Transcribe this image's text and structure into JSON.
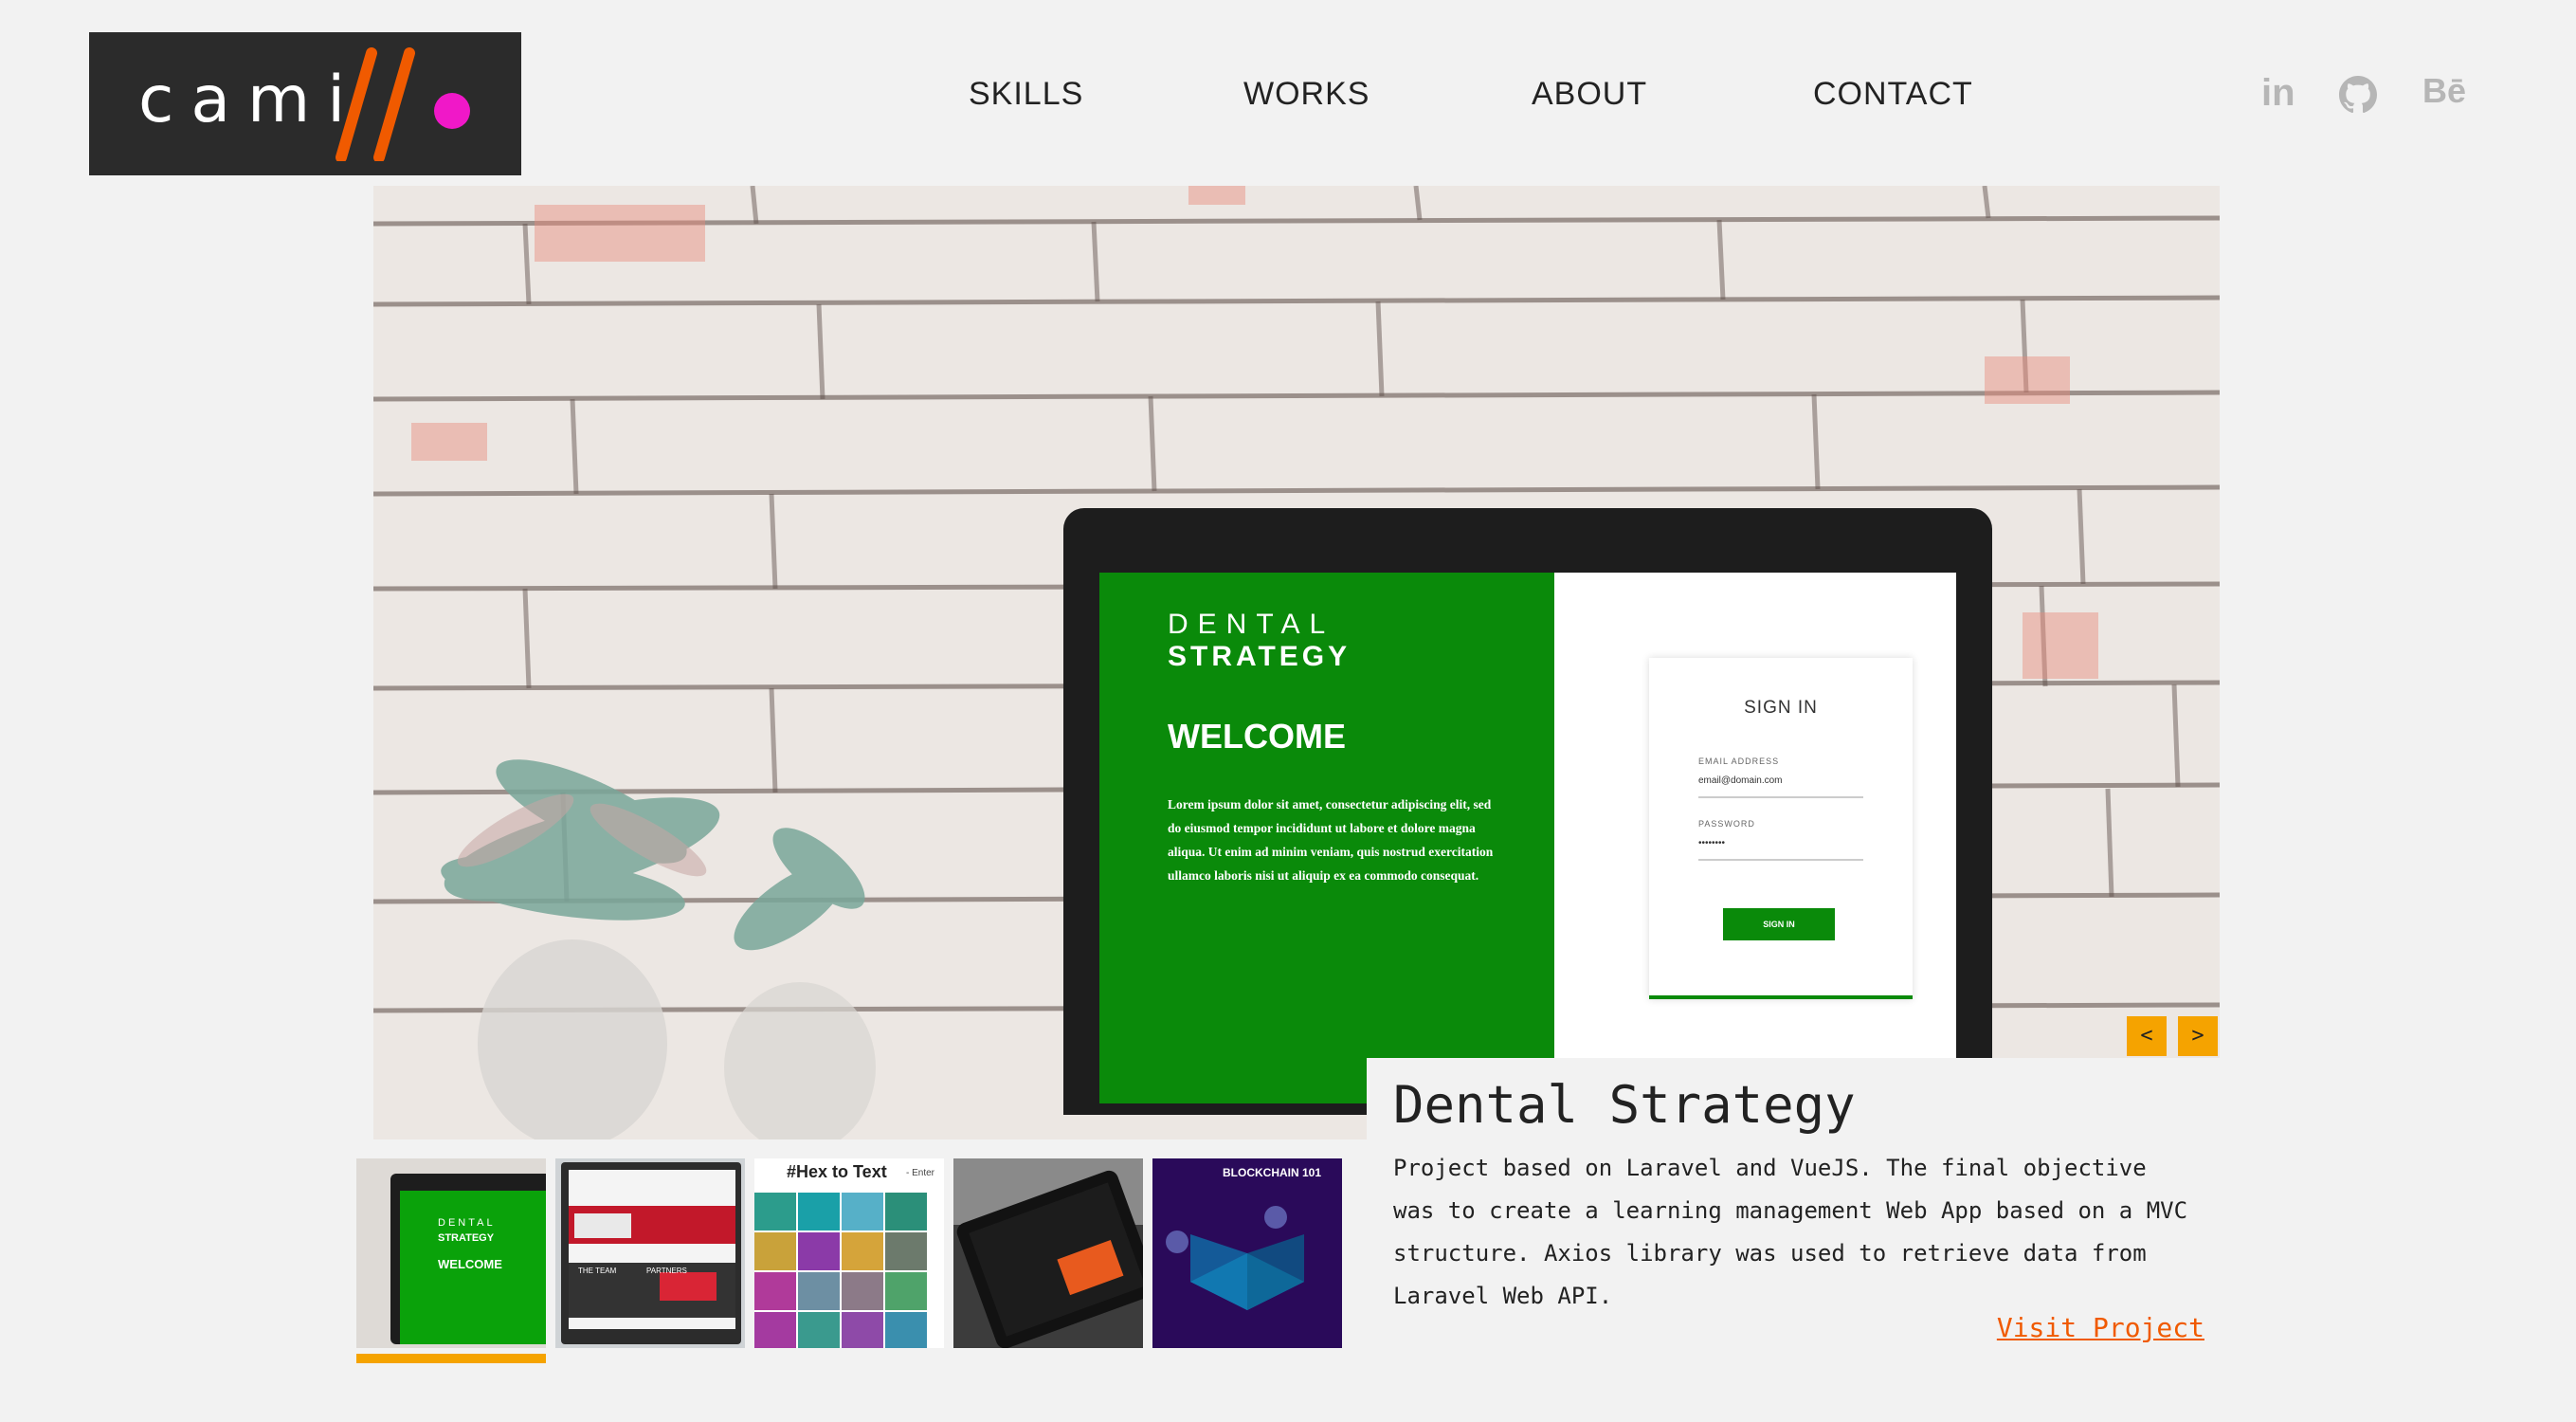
{
  "logo": {
    "text": "cami"
  },
  "nav": {
    "items": [
      "SKILLS",
      "WORKS",
      "ABOUT",
      "CONTACT"
    ]
  },
  "social": {
    "linkedin": "in",
    "github_icon": "github-icon",
    "behance": "Bē"
  },
  "hero": {
    "screen": {
      "brand_top": "DENTAL",
      "brand_bottom": "STRATEGY",
      "welcome": "WELCOME",
      "lorem": "Lorem ipsum dolor sit amet, consectetur adipiscing elit, sed do eiusmod tempor incididunt ut labore et dolore magna aliqua. Ut enim ad minim veniam, quis nostrud exercitation ullamco laboris nisi ut aliquip ex ea commodo consequat.",
      "signin_title": "SIGN IN",
      "email_label": "EMAIL ADDRESS",
      "email_value": "email@domain.com",
      "password_label": "PASSWORD",
      "password_value": "••••••••",
      "signin_button": "SIGN IN"
    },
    "prev_label": "<",
    "next_label": ">"
  },
  "project": {
    "title": "Dental Strategy",
    "description": "Project based on Laravel and VueJS. The final objective was to create a learning management Web App based on a MVC structure. Axios library was used to retrieve data from Laravel Web API.",
    "visit_label": "Visit Project"
  },
  "thumbnails": {
    "t1": {
      "line1": "DENTAL",
      "line2": "STRATEGY",
      "line3": "WELCOME"
    },
    "t2": {
      "line1": "THE TEAM",
      "line2": "PARTNERS"
    },
    "t3": {
      "line1": "#Hex to Text",
      "line2": "- Enter"
    },
    "t5": {
      "line1": "BLOCKCHAIN 101"
    }
  },
  "colors": {
    "accent": "#f5a300",
    "link": "#f05a00",
    "logo_bg": "#2b2b2b",
    "logo_slash": "#f05a00",
    "logo_dot": "#f018c8",
    "dental_green": "#0a8a0a"
  }
}
